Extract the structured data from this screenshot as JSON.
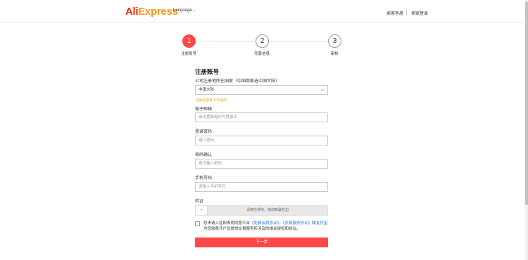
{
  "header": {
    "logo_ali": "Ali",
    "logo_express": "Express",
    "language": "Language",
    "seller_manual": "卖家手册",
    "seller_login": "卖家登录"
  },
  "steps": [
    {
      "number": "1",
      "label": "注册账号",
      "active": true
    },
    {
      "number": "2",
      "label": "完善信息",
      "active": false
    },
    {
      "number": "3",
      "label": "审核",
      "active": false
    }
  ],
  "form": {
    "title": "注册账号",
    "country_label": "公司注册地所在国家（中国商家选中国大陆）",
    "country_value": "中国大陆",
    "country_hint": "注册后国家不可更改",
    "email_label": "电子邮箱",
    "email_placeholder": "请设置邮箱作为登录名",
    "password_label": "登录密码",
    "password_placeholder": "输入密码",
    "confirm_label": "密码确认",
    "confirm_placeholder": "再次输入密码",
    "phone_label": "手机号码",
    "phone_placeholder": "请输入手机号码",
    "verify_label": "验证",
    "slider_handle": ">>",
    "slider_text": "请按住滑块，拖动到最右边",
    "agree_prefix": "您申请入驻即表明同意平台",
    "agree_link1": "《免费会员协议》",
    "agree_mid": "、",
    "agree_link2": "《交易服务协议》",
    "agree_and": "和",
    "agree_link3": "支付宝",
    "agree_suffix": "为您收费开户及提供交易服务所涉及的相关授权和协议。",
    "next_button": "下一步"
  },
  "colors": {
    "brand_red": "#ff4747",
    "logo_red": "#e62e04",
    "logo_orange": "#f7971d",
    "hint_orange": "#f5a623",
    "link_blue": "#1a73e8"
  },
  "icons": {
    "select_arrow": "chevron-down-icon",
    "language_arrow": "chevron-down-icon"
  }
}
